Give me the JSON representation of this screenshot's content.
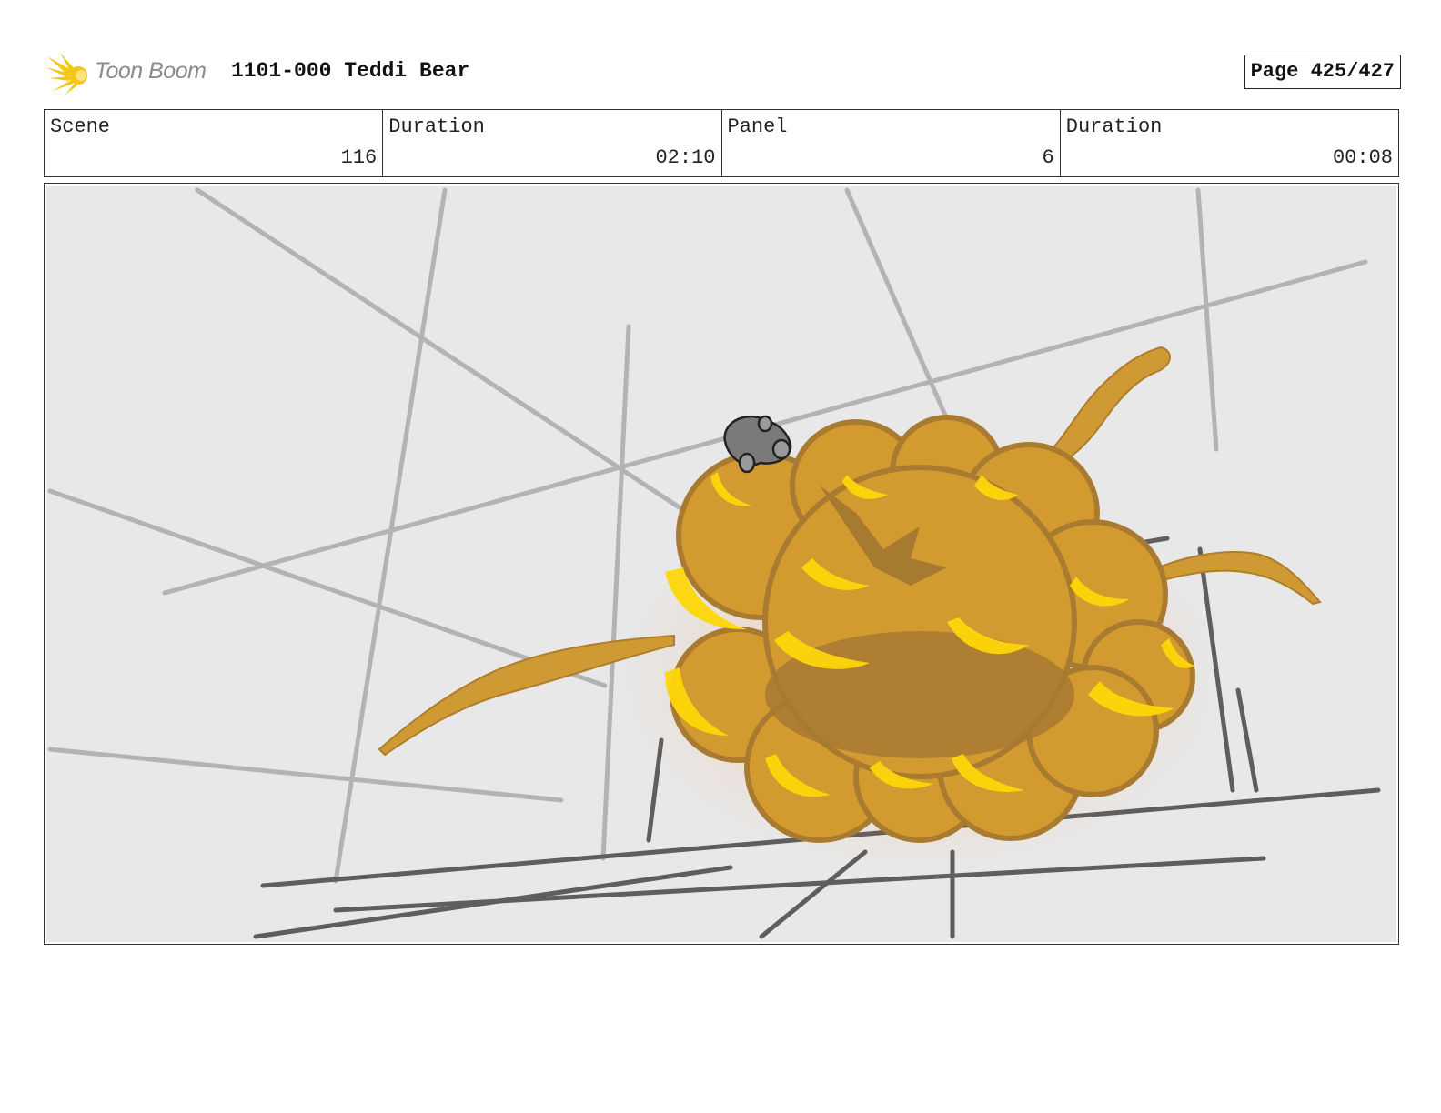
{
  "header": {
    "logo_text": "Toon Boom",
    "project_title": "1101-000 Teddi Bear",
    "page_label": "Page 425/427"
  },
  "info": {
    "scene_label": "Scene",
    "scene_value": "116",
    "scene_duration_label": "Duration",
    "scene_duration_value": "02:10",
    "panel_label": "Panel",
    "panel_value": "6",
    "panel_duration_label": "Duration",
    "panel_duration_value": "00:08"
  },
  "colors": {
    "logo_accent": "#f5c518",
    "panel_bg": "#e8e8e8",
    "explosion_body": "#d39a30",
    "explosion_core": "#ffd60a",
    "explosion_shadow": "#a77a32"
  }
}
